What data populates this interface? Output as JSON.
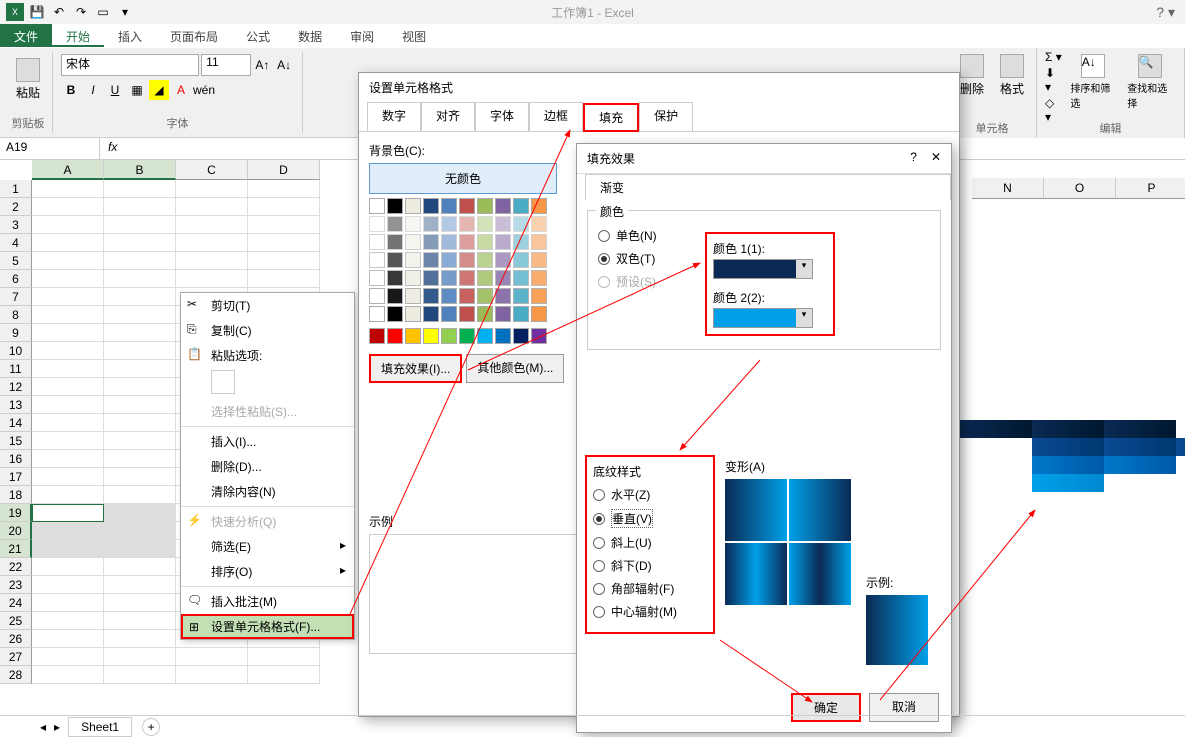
{
  "title": "工作簿1 - Excel",
  "ribbon_tabs": [
    "文件",
    "开始",
    "插入",
    "页面布局",
    "公式",
    "数据",
    "审阅",
    "视图"
  ],
  "clipboard": {
    "paste": "粘贴",
    "group": "剪贴板"
  },
  "font": {
    "name": "宋体",
    "size": "11",
    "group": "字体"
  },
  "cells_group": "单元格",
  "edit_group": "编辑",
  "btn_delete": "删除",
  "btn_format": "格式",
  "btn_sort": "排序和筛选",
  "btn_find": "查找和选择",
  "name_box": "A19",
  "columns": [
    "A",
    "B",
    "C",
    "D",
    "N",
    "O",
    "P"
  ],
  "sheet_tab": "Sheet1",
  "context_menu": {
    "cut": "剪切(T)",
    "copy": "复制(C)",
    "paste_options": "粘贴选项:",
    "paste_special": "选择性粘贴(S)...",
    "insert": "插入(I)...",
    "delete": "删除(D)...",
    "clear": "清除内容(N)",
    "quick": "快速分析(Q)",
    "filter": "筛选(E)",
    "sort": "排序(O)",
    "comment": "插入批注(M)",
    "format": "设置单元格格式(F)..."
  },
  "dlg1": {
    "title": "设置单元格格式",
    "tabs": [
      "数字",
      "对齐",
      "字体",
      "边框",
      "填充",
      "保护"
    ],
    "bg_label": "背景色(C):",
    "no_color": "无颜色",
    "fill_effects": "填充效果(I)...",
    "other_colors": "其他颜色(M)...",
    "example": "示例"
  },
  "dlg2": {
    "title": "填充效果",
    "tab": "渐变",
    "colors_label": "颜色",
    "radio_one": "单色(N)",
    "radio_two": "双色(T)",
    "radio_preset": "预设(S)",
    "color1": "颜色 1(1):",
    "color2": "颜色 2(2):",
    "shading_label": "底纹样式",
    "radio_h": "水平(Z)",
    "radio_v": "垂直(V)",
    "radio_du": "斜上(U)",
    "radio_dd": "斜下(D)",
    "radio_corner": "角部辐射(F)",
    "radio_center": "中心辐射(M)",
    "variants": "变形(A)",
    "sample": "示例:",
    "ok": "确定",
    "cancel": "取消"
  },
  "colors": {
    "c1": "#0a2a54",
    "c2": "#00a0e9"
  }
}
